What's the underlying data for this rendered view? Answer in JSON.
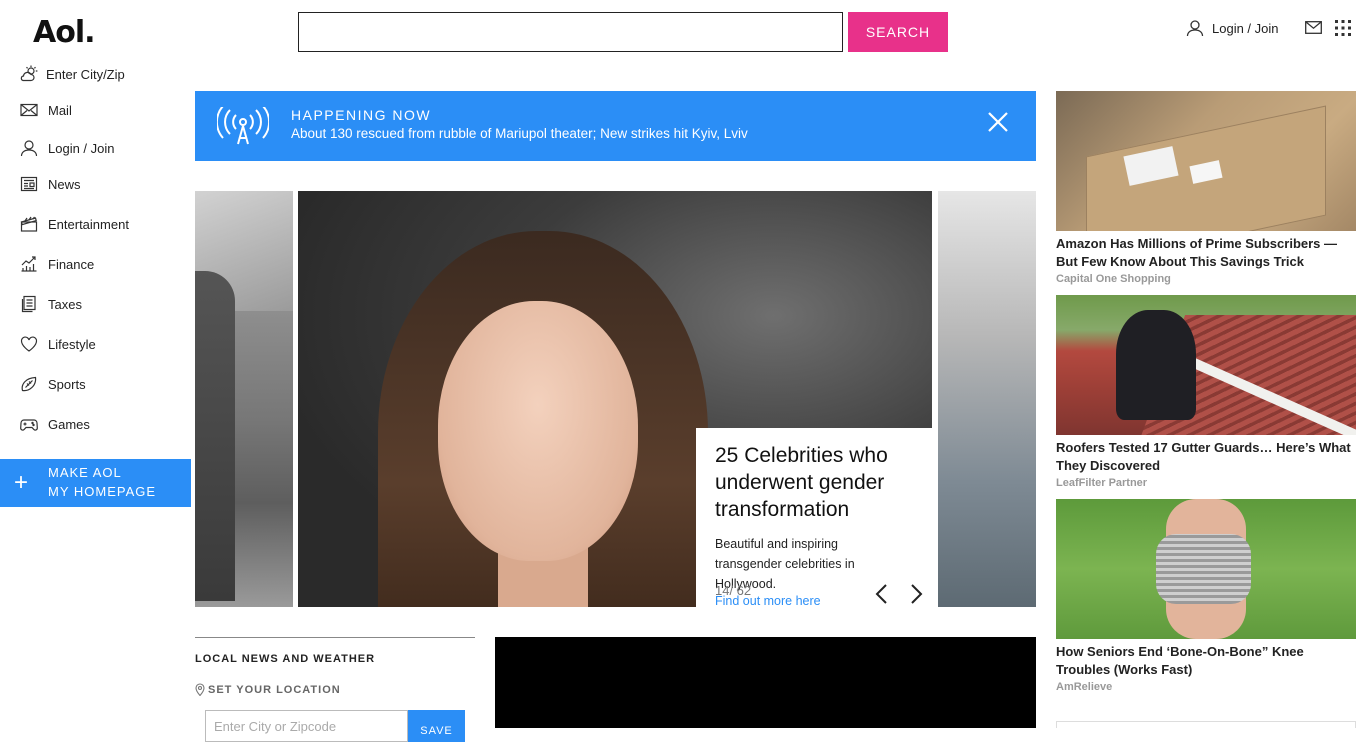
{
  "header": {
    "logo": "Aol.",
    "search_placeholder": "",
    "search_button": "SEARCH",
    "login": "Login / Join"
  },
  "sidebar": {
    "items": [
      {
        "label": "Enter City/Zip",
        "icon": "weather-icon"
      },
      {
        "label": "Mail",
        "icon": "mail-icon"
      },
      {
        "label": "Login / Join",
        "icon": "user-icon"
      },
      {
        "label": "News",
        "icon": "news-icon"
      },
      {
        "label": "Entertainment",
        "icon": "clapper-icon"
      },
      {
        "label": "Finance",
        "icon": "chart-icon"
      },
      {
        "label": "Taxes",
        "icon": "document-icon"
      },
      {
        "label": "Lifestyle",
        "icon": "heart-icon"
      },
      {
        "label": "Sports",
        "icon": "football-icon"
      },
      {
        "label": "Games",
        "icon": "gamepad-icon"
      }
    ],
    "make_home_line1": "MAKE AOL",
    "make_home_line2": "MY HOMEPAGE"
  },
  "happening": {
    "label": "HAPPENING NOW",
    "headline": "About 130 rescued from rubble of Mariupol theater; New strikes hit Kyiv, Lviv"
  },
  "slideshow": {
    "title": "25 Celebrities who underwent gender transformation",
    "description": "Beautiful and inspiring transgender celebrities in Hollywood.",
    "counter": "14/ 62",
    "link": "Find out more here"
  },
  "local": {
    "title": "LOCAL NEWS AND WEATHER",
    "set_location": "SET YOUR LOCATION",
    "input_placeholder": "Enter City or Zipcode",
    "save": "SAVE"
  },
  "ads": [
    {
      "headline": "Amazon Has Millions of Prime Subscribers — But Few Know About This Savings Trick",
      "sponsor": "Capital One Shopping"
    },
    {
      "headline": "Roofers Tested 17 Gutter Guards… Here’s What They Discovered",
      "sponsor": "LeafFilter Partner"
    },
    {
      "headline": "How Seniors End ‘Bone-On-Bone” Knee Troubles (Works Fast)",
      "sponsor": "AmRelieve"
    }
  ],
  "colors": {
    "accent_blue": "#2b8ef6",
    "search_pink": "#e8318a"
  }
}
